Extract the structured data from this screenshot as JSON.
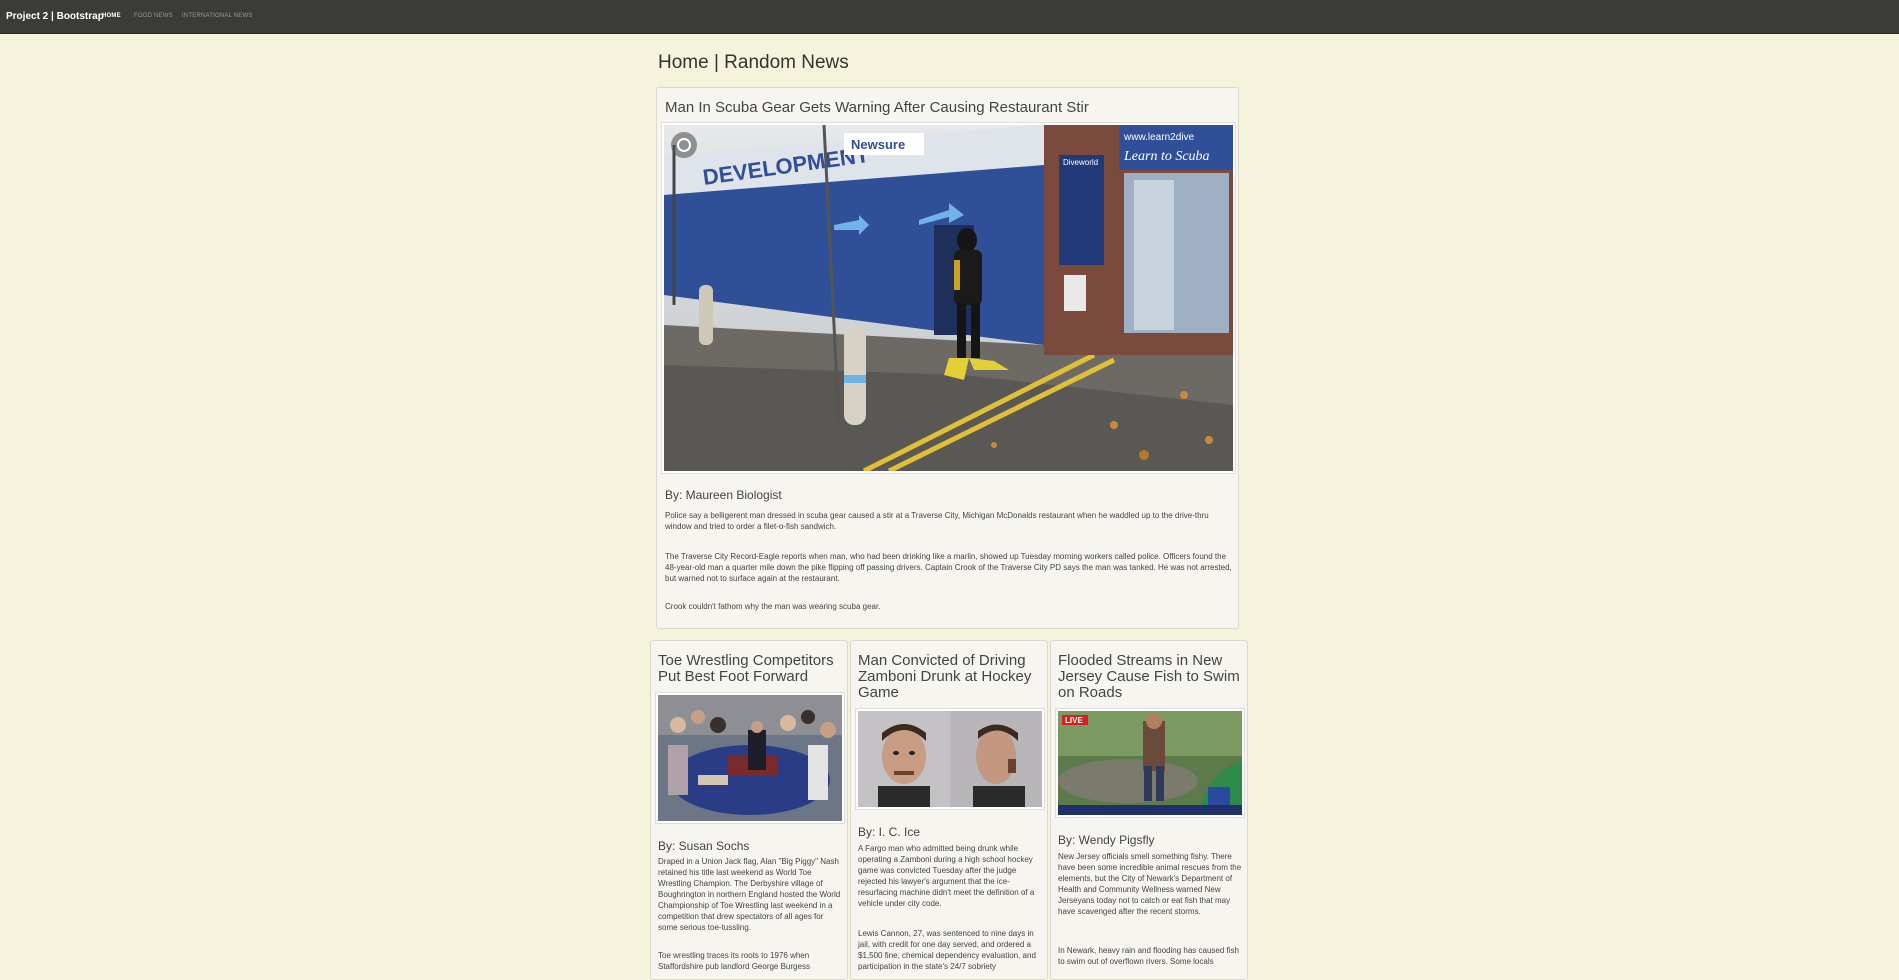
{
  "navbar": {
    "brand": "Project 2 | Bootstrap",
    "links": [
      "HOME",
      "FOOD NEWS",
      "INTERNATIONAL NEWS"
    ]
  },
  "page_title": "Home | Random News",
  "main_article": {
    "title": "Man In Scuba Gear Gets Warning After Causing Restaurant Stir",
    "photo_signs": {
      "left": "DEVELOPMENT",
      "store": "Newsure",
      "brand": "Diveworld",
      "banner": "Learn to Scuba",
      "url": "www.learn2dive"
    },
    "byline": "By: Maureen Biologist",
    "paragraphs": [
      "Police say a belligerent man dressed in scuba gear caused a stir at a Traverse City, Michigan McDonalds restaurant when he waddled up to the drive-thru window and tried to order a filet-o-fish sandwich.",
      "The Traverse City Record-Eagle reports when man, who had been drinking like a marlin, showed up Tuesday morning workers called police. Officers found the 48-year-old man a quarter mile down the pike flipping off passing drivers. Captain Crook of the Traverse City PD says the man was tanked. He was not arrested, but warned not to surface again at the restaurant.",
      "Crook couldn't fathom why the man was wearing scuba gear."
    ]
  },
  "articles": [
    {
      "title": "Toe Wrestling Competitors Put Best Foot Forward",
      "byline": "By: Susan Sochs",
      "paragraphs": [
        "Draped in a Union Jack flag, Alan \"Big Piggy\" Nash retained his title last weekend as World Toe Wrestling Champion. The Derbyshire village of Boughrington in northern England hosted the World Championship of Toe Wrestling last weekend in a competition that drew spectators of all ages for some serious toe-tussling.",
        "Toe wrestling traces its roots to 1976 when Staffordshire pub landlord George Burgess"
      ]
    },
    {
      "title": "Man Convicted of Driving Zamboni Drunk at Hockey Game",
      "byline": "By: I. C. Ice",
      "paragraphs": [
        "A Fargo man who admitted being drunk while operating a Zamboni during a high school hockey game was convicted Tuesday after the judge rejected his lawyer's argument that the ice-resurfacing machine didn't meet the definition of a vehicle under city code.",
        "Lewis Cannon, 27, was sentenced to nine days in jail, with credit for one day served, and ordered a $1,500 fine, chemical dependency evaluation, and participation in the state's 24/7 sobriety"
      ]
    },
    {
      "title": "Flooded Streams in New Jersey Cause Fish to Swim on Roads",
      "byline": "By: Wendy Pigsfly",
      "live_badge": "LIVE",
      "paragraphs": [
        "New Jersey officials smell something fishy. There have been some incredible animal rescues from the elements, but the City of Newark's Department of Health and Community Wellness warned New Jerseyans today not to catch or eat fish that may have scavenged after the recent storms.",
        "In Newark, heavy rain and flooding has caused fish to swim out of overflown rivers. Some locals"
      ]
    }
  ]
}
